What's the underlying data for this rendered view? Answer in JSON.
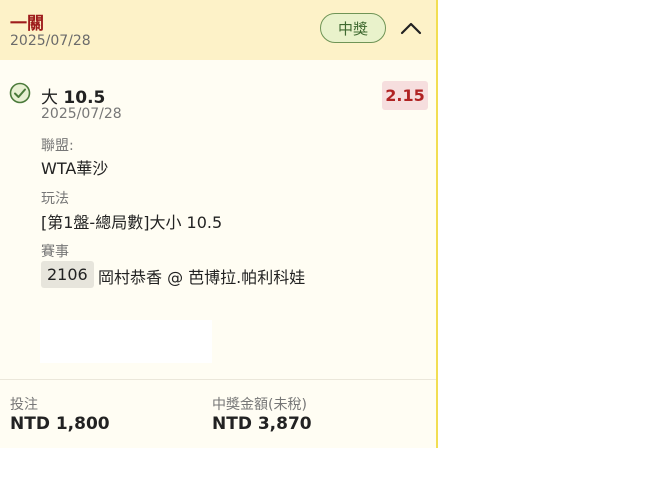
{
  "header": {
    "title": "一關",
    "date": "2025/07/28",
    "status_badge": "中獎",
    "collapse_icon": "chevron-up-icon"
  },
  "selection": {
    "check_icon": "check-circle-icon",
    "prefix": "大",
    "line": "10.5",
    "date": "2025/07/28",
    "odds": "2.15"
  },
  "fields": {
    "league_label": "聯盟:",
    "league_value": "WTA華沙",
    "market_label": "玩法",
    "market_value": "[第1盤-總局數]大小 10.5",
    "event_label": "賽事",
    "event_id": "2106",
    "event_name": "岡村恭香 @ 芭博拉.帕利科娃"
  },
  "footer": {
    "stake_label": "投注",
    "stake_value": "NTD 1,800",
    "payout_label": "中獎金額(未稅)",
    "payout_value": "NTD 3,870"
  },
  "colors": {
    "header_bg": "#fdf2c8",
    "card_bg": "#fffdf3",
    "title_red": "#9e1c1c",
    "win_green": "#3f6930",
    "odds_red": "#b02323",
    "accent_border": "#f2de52"
  }
}
